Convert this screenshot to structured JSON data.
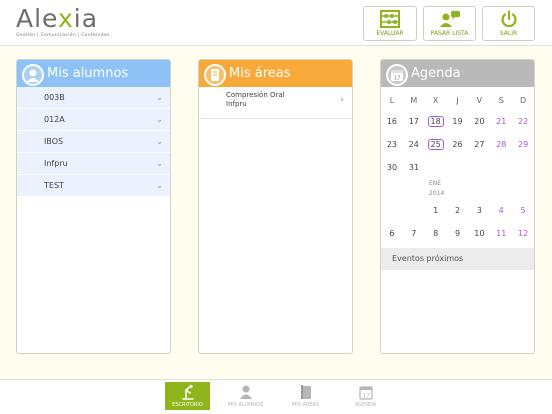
{
  "brand": {
    "logo_main": "Ale",
    "logo_x": "x",
    "logo_end": "ia",
    "tagline": "Gestión | Comunicación | Contenidos"
  },
  "toolbar": {
    "evaluar_label": "EVALUAR",
    "pasar_lista_label": "PASAR LISTA",
    "salir_label": "SALIR"
  },
  "alumnos": {
    "title": "Mis alumnos",
    "items": [
      {
        "label": "003B"
      },
      {
        "label": "012A"
      },
      {
        "label": "IBOS"
      },
      {
        "label": "Infpru"
      },
      {
        "label": "TEST"
      }
    ]
  },
  "areas": {
    "title": "Mis áreas",
    "items": [
      {
        "name": "Compresión Oral",
        "group": "Infpru"
      }
    ]
  },
  "agenda": {
    "title": "Agenda",
    "calendar_icon_day": "17",
    "weekdays": [
      "L",
      "M",
      "X",
      "J",
      "V",
      "S",
      "D"
    ],
    "week1": [
      "16",
      "17",
      "18",
      "19",
      "20",
      "21",
      "22"
    ],
    "week2": [
      "23",
      "24",
      "25",
      "26",
      "27",
      "28",
      "29"
    ],
    "week3": [
      "30",
      "31"
    ],
    "month_label": "ENE",
    "year_label": "2014",
    "week4": [
      "1",
      "2",
      "3",
      "4",
      "5"
    ],
    "week5": [
      "6",
      "7",
      "8",
      "9",
      "10",
      "11",
      "12"
    ],
    "events_label": "Eventos próximos"
  },
  "tabs": [
    {
      "label": "ESCRITORIO",
      "active": true
    },
    {
      "label": "MIS ALUMNOS",
      "active": false
    },
    {
      "label": "MIS ÁREAS",
      "active": false
    },
    {
      "label": "AGENDA",
      "active": false
    }
  ],
  "colors": {
    "accent_green": "#8fb51c",
    "alumnos_blue": "#8ec2f6",
    "areas_orange": "#f7a93a",
    "agenda_gray": "#b9b9b9",
    "weekend_purple": "#a05ad8"
  }
}
